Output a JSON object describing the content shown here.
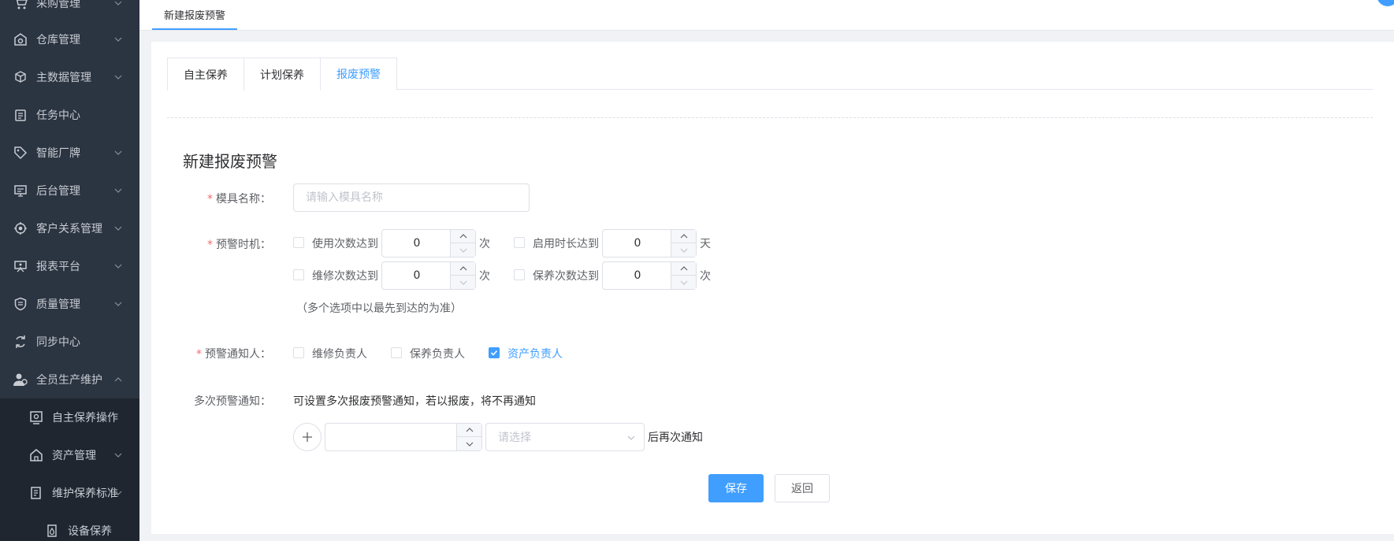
{
  "sidebar": {
    "items": [
      {
        "label": "采购管理",
        "icon": "cart-icon"
      },
      {
        "label": "仓库管理",
        "icon": "warehouse-icon"
      },
      {
        "label": "主数据管理",
        "icon": "cube-icon"
      },
      {
        "label": "任务中心",
        "icon": "clipboard-icon"
      },
      {
        "label": "智能厂牌",
        "icon": "tag-icon"
      },
      {
        "label": "后台管理",
        "icon": "monitor-icon"
      },
      {
        "label": "客户关系管理",
        "icon": "target-icon"
      },
      {
        "label": "报表平台",
        "icon": "board-icon"
      },
      {
        "label": "质量管理",
        "icon": "shield-icon"
      },
      {
        "label": "同步中心",
        "icon": "sync-icon"
      },
      {
        "label": "全员生产维护",
        "icon": "users-icon"
      },
      {
        "label": "自主保养操作",
        "icon": "screen-icon"
      },
      {
        "label": "资产管理",
        "icon": "home-icon"
      },
      {
        "label": "维护保养标准",
        "icon": "doc-icon"
      },
      {
        "label": "设备保养",
        "icon": "drop-icon"
      }
    ]
  },
  "topbar": {
    "tab_label": "新建报废预警"
  },
  "tabs": [
    {
      "label": "自主保养"
    },
    {
      "label": "计划保养"
    },
    {
      "label": "报废预警"
    }
  ],
  "form": {
    "title": "新建报废预警",
    "mold_name_label": "模具名称：",
    "mold_name_placeholder": "请输入模具名称",
    "timing_label": "预警时机：",
    "timing": [
      {
        "label": "使用次数达到",
        "value": "0",
        "unit": "次"
      },
      {
        "label": "启用时长达到",
        "value": "0",
        "unit": "天"
      },
      {
        "label": "维修次数达到",
        "value": "0",
        "unit": "次"
      },
      {
        "label": "保养次数达到",
        "value": "0",
        "unit": "次"
      }
    ],
    "timing_hint": "（多个选项中以最先到达的为准）",
    "notify_label": "预警通知人：",
    "notify": [
      {
        "label": "维修负责人",
        "checked": false
      },
      {
        "label": "保养负责人",
        "checked": false
      },
      {
        "label": "资产负责人",
        "checked": true
      }
    ],
    "multi_label": "多次预警通知：",
    "multi_hint": "可设置多次报废预警通知，若以报废，将不再通知",
    "select_placeholder": "请选择",
    "after_text": "后再次通知",
    "save": "保存",
    "back": "返回"
  },
  "colors": {
    "accent": "#409eff",
    "required": "#f56c6c",
    "sidebar": "#2b3441"
  }
}
